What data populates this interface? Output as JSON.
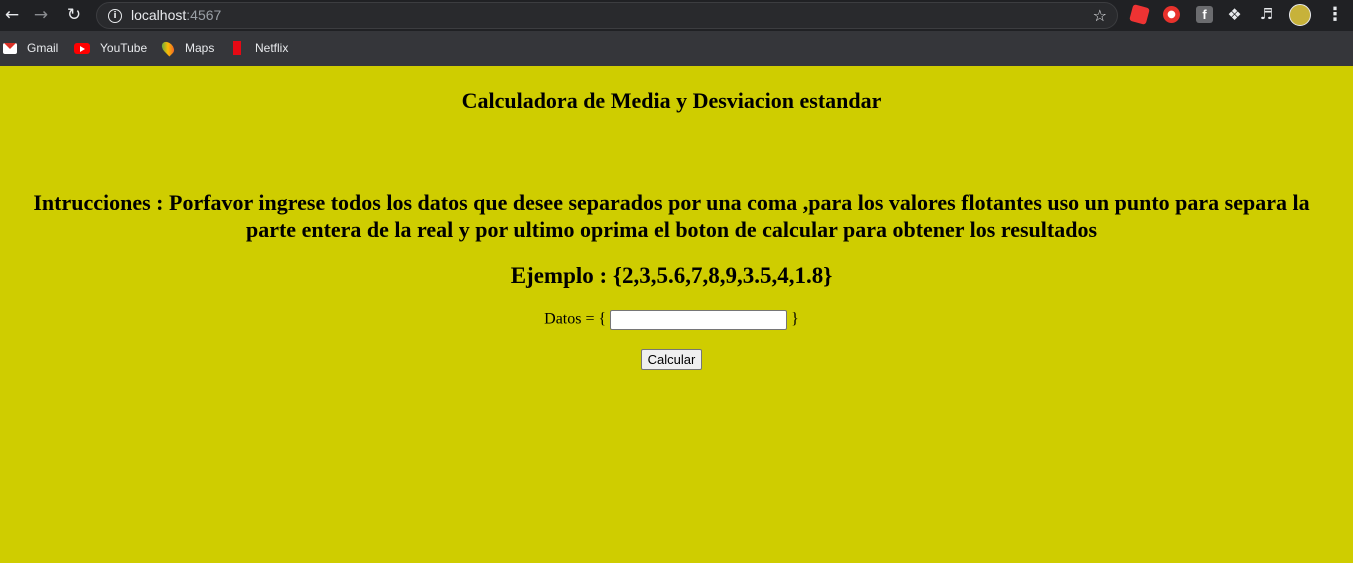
{
  "browser": {
    "url_host": "localhost",
    "url_port": ":4567",
    "bookmarks": [
      {
        "label": "Gmail"
      },
      {
        "label": "YouTube"
      },
      {
        "label": "Maps"
      },
      {
        "label": "Netflix"
      }
    ],
    "ext_f_label": "f"
  },
  "page": {
    "title": "Calculadora de Media y Desviacion estandar",
    "instructions": "Intrucciones : Porfavor ingrese todos los datos que desee separados por una coma ,para los valores flotantes uso un punto para separa la parte entera de la real y por ultimo oprima el boton de calcular para obtener los resultados",
    "example": "Ejemplo : {2,3,5.6,7,8,9,3.5,4,1.8}",
    "datos_prefix": "Datos = {",
    "datos_suffix": "}",
    "datos_value": "",
    "calcular_label": "Calcular"
  },
  "colors": {
    "page_background": "#cfcd00",
    "chrome_background": "#35363a"
  }
}
